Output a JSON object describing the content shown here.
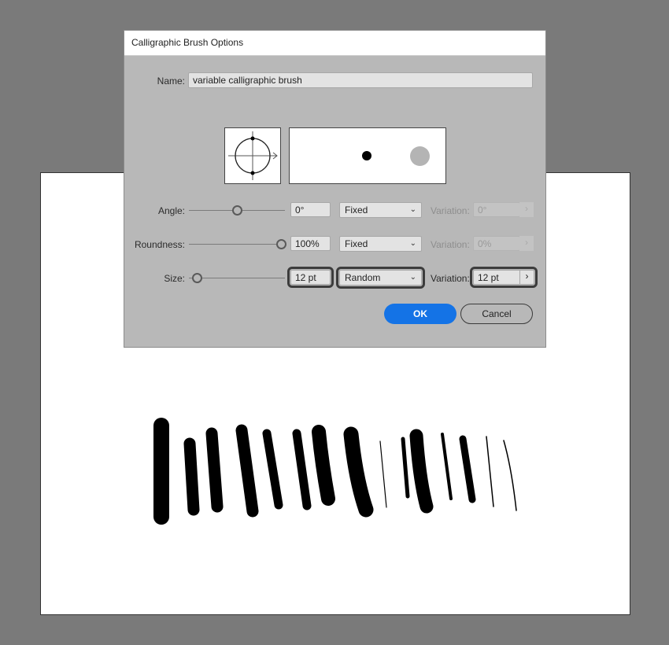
{
  "dialog": {
    "title": "Calligraphic Brush Options",
    "name_label": "Name:",
    "name_value": "variable calligraphic brush",
    "angle": {
      "label": "Angle:",
      "value": "0°",
      "mode": "Fixed",
      "variation_label": "Variation:",
      "variation_value": "0°"
    },
    "roundness": {
      "label": "Roundness:",
      "value": "100%",
      "mode": "Fixed",
      "variation_label": "Variation:",
      "variation_value": "0%"
    },
    "size": {
      "label": "Size:",
      "value": "12 pt",
      "mode": "Random",
      "variation_label": "Variation:",
      "variation_value": "12 pt"
    },
    "ok_label": "OK",
    "cancel_label": "Cancel"
  },
  "icons": {
    "dropdown": "chevron-down-icon",
    "stepper": "chevron-right-icon",
    "angle_preview": "brush-angle-preview-icon"
  },
  "colors": {
    "background": "#7a7a7a",
    "dialog": "#b8b8b8",
    "accent": "#1473e6",
    "artboard": "#ffffff"
  }
}
